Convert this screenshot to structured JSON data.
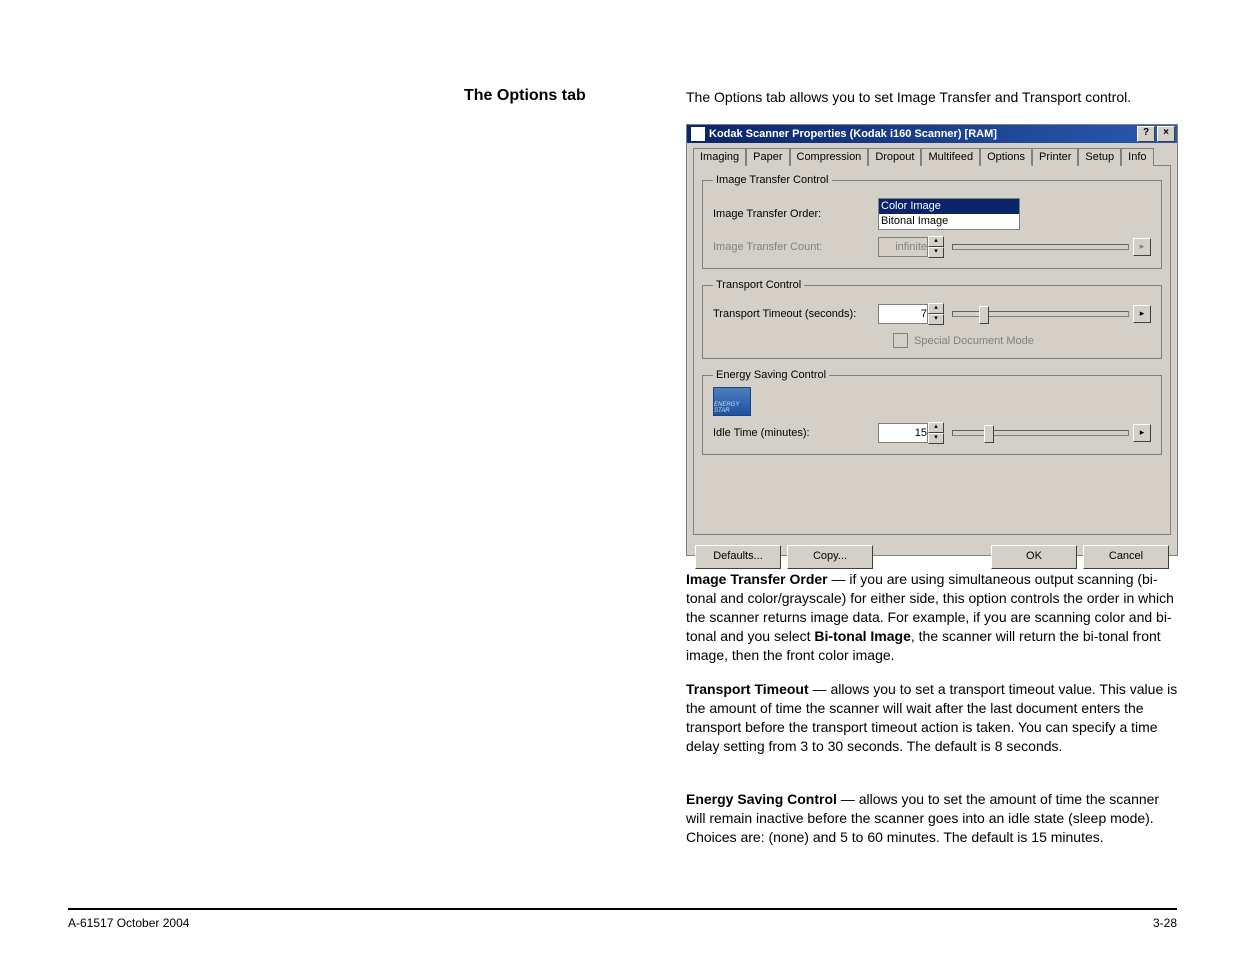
{
  "section_title": "The Options tab",
  "intro_text": "The Options tab allows you to set Image Transfer and Transport control.",
  "dialog": {
    "title": "Kodak Scanner Properties (Kodak i160 Scanner) [RAM]",
    "help_btn": "?",
    "close_btn": "×",
    "tabs": [
      "Imaging",
      "Paper",
      "Compression",
      "Dropout",
      "Multifeed",
      "Options",
      "Printer",
      "Setup",
      "Info"
    ],
    "active_tab": "Options",
    "groups": {
      "image_transfer": {
        "legend": "Image Transfer Control",
        "order_label": "Image Transfer Order:",
        "order_options": [
          "Color Image",
          "Bitonal Image"
        ],
        "count_label": "Image Transfer Count:",
        "count_value": "infinite"
      },
      "transport": {
        "legend": "Transport Control",
        "timeout_label": "Transport Timeout (seconds):",
        "timeout_value": "7",
        "special_mode_label": "Special Document Mode"
      },
      "energy": {
        "legend": "Energy Saving Control",
        "logo_caption": "ENERGY STAR",
        "idle_label": "Idle Time (minutes):",
        "idle_value": "15"
      }
    },
    "buttons": {
      "defaults": "Defaults...",
      "copy": "Copy...",
      "ok": "OK",
      "cancel": "Cancel"
    }
  },
  "paragraphs": {
    "p1_label": "Image Transfer Order",
    "p1_dash": " — ",
    "p1_a": "if you are using simultaneous output scanning (bi-tonal and color/grayscale) for either side, this option controls the order in which the scanner returns image data. For example, if you are scanning color and bi-tonal and you select ",
    "p1_bold": "Bi-tonal Image",
    "p1_b": ", the scanner will return the bi-tonal front image, then the front color image.",
    "p2_label": "Transport Timeout",
    "p2_dash": " — ",
    "p2": "allows you to set a transport timeout value. This value is the amount of time the scanner will wait after the last document enters the transport before the transport timeout action is taken. You can specify a time delay setting from 3 to 30 seconds. The default is 8 seconds.",
    "p3_label": "Energy Saving Control",
    "p3_dash": " — ",
    "p3": "allows you to set the amount of time the scanner will remain inactive before the scanner goes into an idle state (sleep mode). Choices are: (none) and 5 to 60 minutes. The default is 15 minutes."
  },
  "footer": {
    "left": "A-61517  October 2004",
    "right": "3-28"
  }
}
